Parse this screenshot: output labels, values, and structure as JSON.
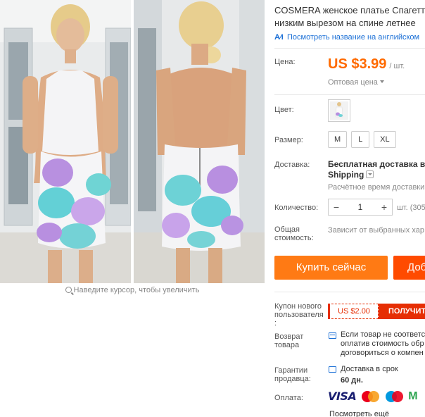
{
  "gallery": {
    "zoom_hint": "Наведите курсор, чтобы увеличить"
  },
  "product": {
    "title_line1": "COSMERA женское платье Спагетт",
    "title_line2": "низким вырезом на спине летнее",
    "translate_link": "Посмотреть название на английском"
  },
  "price": {
    "label": "Цена:",
    "amount": "US $3.99",
    "unit": "/ шт.",
    "wholesale": "Оптовая цена"
  },
  "color": {
    "label": "Цвет:"
  },
  "size": {
    "label": "Размер:",
    "options": [
      "M",
      "L",
      "XL"
    ]
  },
  "shipping": {
    "label": "Доставка:",
    "line1": "Бесплатная доставка в Ru",
    "line2": "Shipping",
    "estimate": "Расчётное время доставки"
  },
  "quantity": {
    "label": "Количество:",
    "minus": "−",
    "value": "1",
    "plus": "+",
    "note": "шт. (305"
  },
  "total": {
    "label_line1": "Общая",
    "label_line2": "стоимость:",
    "note": "Зависит от выбранных хар"
  },
  "actions": {
    "buy_now": "Купить сейчас",
    "add_to_cart": "Доб"
  },
  "coupon": {
    "label_line1": "Купон нового",
    "label_line2": "пользователя",
    "label_line3": ":",
    "amount": "US $2.00",
    "get": "ПОЛУЧИТЕ"
  },
  "returns": {
    "label_line1": "Возврат",
    "label_line2": "товара",
    "text_line1": "Если товар не соответст",
    "text_line2": "оплатив стоимость обр",
    "text_line3": "договориться о компен"
  },
  "guarantee": {
    "label_line1": "Гарантии",
    "label_line2": "продавца:",
    "text": "Доставка в срок",
    "days": "60 дн."
  },
  "payment": {
    "label": "Оплата:",
    "visa": "VISA",
    "more": "Посмотреть ещё"
  },
  "colors": {
    "accent_orange": "#ff6a00",
    "buy_button": "#ff7a14",
    "cart_button": "#ff4b00",
    "coupon_red": "#e62e04",
    "link_blue": "#1a6fd6"
  }
}
